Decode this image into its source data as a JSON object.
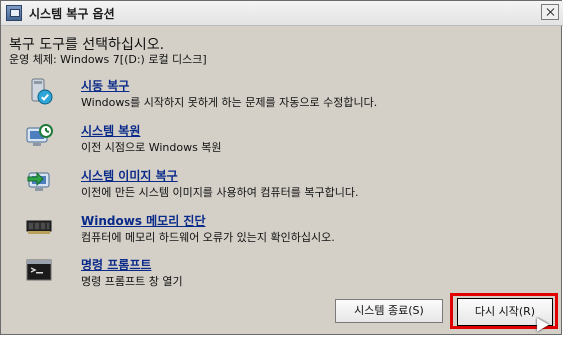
{
  "window": {
    "title": "시스템 복구 옵션"
  },
  "intro": {
    "heading": "복구 도구를 선택하십시오.",
    "os_line": "운영 체제: Windows 7[(D:) 로컬 디스크]"
  },
  "options": [
    {
      "title": "시동 복구",
      "desc": "Windows를 시작하지 못하게 하는 문제를 자동으로 수정합니다.",
      "icon": "startup-repair-icon"
    },
    {
      "title": "시스템 복원",
      "desc": "이전 시점으로 Windows 복원",
      "icon": "system-restore-icon"
    },
    {
      "title": "시스템 이미지 복구",
      "desc": "이전에 만든 시스템 이미지를 사용하여 컴퓨터를 복구합니다.",
      "icon": "system-image-icon"
    },
    {
      "title": "Windows 메모리 진단",
      "desc": "컴퓨터에 메모리 하드웨어 오류가 있는지 확인하십시오.",
      "icon": "memory-diagnostic-icon"
    },
    {
      "title": "명령 프롬프트",
      "desc": "명령 프롬프트 창 열기",
      "icon": "command-prompt-icon"
    }
  ],
  "buttons": {
    "shutdown": "시스템 종료(S)",
    "restart": "다시 시작(R)"
  },
  "highlight_color": "#e00000"
}
